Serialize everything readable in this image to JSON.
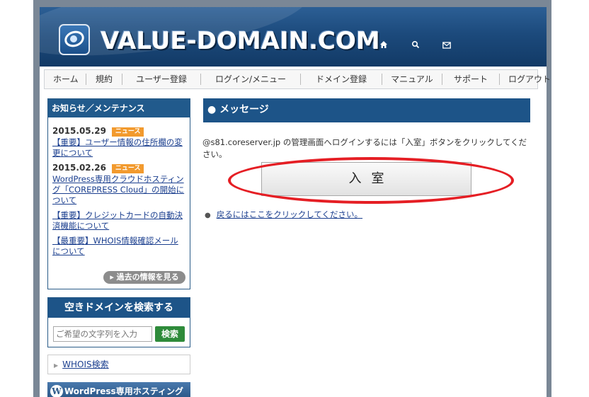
{
  "site": {
    "title": "VALUE-DOMAIN.COM"
  },
  "header_icons": [
    "home-icon",
    "search-icon",
    "mail-icon"
  ],
  "nav": {
    "items": [
      "ホーム",
      "規約",
      "ユーザー登録",
      "ログイン/メニュー",
      "ドメイン登録",
      "マニュアル",
      "サポート",
      "ログアウト"
    ]
  },
  "news": {
    "heading": "お知らせ／メンテナンス",
    "items": [
      {
        "date": "2015.05.29",
        "badge": "ニュース",
        "text": "【重要】ユーザー情報の住所欄の変更について"
      },
      {
        "date": "2015.02.26",
        "badge": "ニュース",
        "text": "WordPress専用クラウドホスティング「COREPRESS Cloud」の開始について"
      },
      {
        "date": "",
        "badge": "",
        "text": "【重要】クレジットカードの自動決済機能について"
      },
      {
        "date": "",
        "badge": "",
        "text": "【最重要】WHOIS情報確認メールについて"
      }
    ],
    "more_label": "▸ 過去の情報を見る"
  },
  "search": {
    "heading": "空きドメインを検索する",
    "placeholder": "ご希望の文字列を入力",
    "button_label": "検索"
  },
  "whois": {
    "label": "WHOIS検索"
  },
  "banner": {
    "label": "WordPress専用ホスティング"
  },
  "message": {
    "heading": "● メッセージ",
    "text": "@s81.coreserver.jp の管理画面へログインするには「入室」ボタンをクリックしてください。",
    "enter_label": "入室",
    "back_link": "戻るにはここをクリックしてください。"
  },
  "colors": {
    "header_blue": "#1c4a7c",
    "panel_blue": "#1d5488",
    "badge_orange": "#f29a2e",
    "highlight_red": "#e51e24",
    "search_green": "#2e8b3a"
  }
}
